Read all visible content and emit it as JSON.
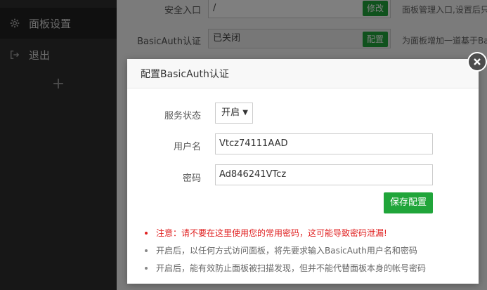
{
  "sidebar": {
    "items": [
      {
        "label": "面板设置",
        "icon": "gear-icon"
      },
      {
        "label": "退出",
        "icon": "logout-icon"
      }
    ],
    "add_label": "+"
  },
  "settings_rows": [
    {
      "label": "安全入口",
      "value": "/",
      "button": "修改",
      "help": "面板管理入口,设置后只"
    },
    {
      "label": "BasicAuth认证",
      "value": "已关闭",
      "button": "配置",
      "help": "为面板增加一道基于Ba"
    }
  ],
  "dialog": {
    "title": "配置BasicAuth认证",
    "close_icon": "close-icon",
    "fields": {
      "status_label": "服务状态",
      "status_value": "开启",
      "status_arrow": "▼",
      "username_label": "用户名",
      "username_value": "Vtcz74111AAD",
      "password_label": "密码",
      "password_value": "Ad846241VTcz"
    },
    "save_label": "保存配置",
    "tips": [
      "注意：请不要在这里使用您的常用密码，这可能导致密码泄漏!",
      "开启后，以任何方式访问面板，将先要求输入BasicAuth用户名和密码",
      "开启后，能有效防止面板被扫描发现，但并不能代替面板本身的帐号密码"
    ]
  },
  "colors": {
    "accent": "#20a53a",
    "warning": "#e02020",
    "sidebar_bg": "#2f2f2f"
  }
}
